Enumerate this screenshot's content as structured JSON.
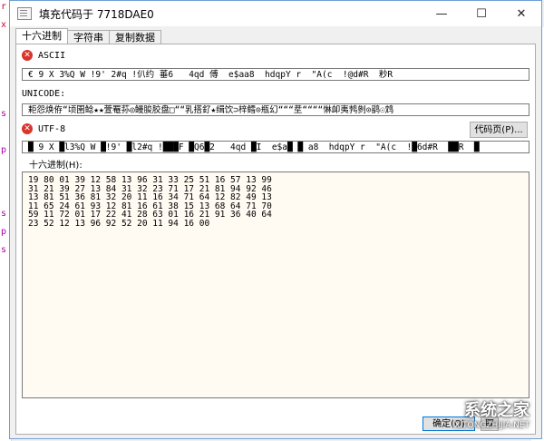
{
  "window": {
    "title": "填充代码于 7718DAE0",
    "minimize": "—",
    "maximize": "☐",
    "close": "✕"
  },
  "tabs": [
    "十六进制",
    "字符串",
    "复制数据"
  ],
  "ascii": {
    "label": "ASCII",
    "value": "€ 9 X 3%Q W !9' 2#q !仈约 菙6   4qd 傅  e$aa8  hdqpY r  \"A(c  !@d#R  粆R"
  },
  "unicode": {
    "label": "UNICODE:",
    "value": "耟怨焕侟“顷圉鲶★★萱罨荪◎鳗朘胶盘□““乳搭釕★缉饮⊃梓鳕⊙瓶幻“““坓““““惏卹夷鹁剼⊙鹞☉鸩"
  },
  "utf8": {
    "label": "UTF-8",
    "value": "█ 9 X █l3%Q W █!9' █l2#q !███F █Q6█2   4qd █I  e$a█ █ a8  hdqpY r  \"A(c  !█6d#R  ██R  █"
  },
  "codepage_button": "代码页(P)...",
  "hex": {
    "label": "十六进制(H):",
    "lines": [
      "19 80 01 39 12 58 13 96 31 33 25 51 16 57 13 99",
      "31 21 39 27 13 84 31 32 23 71 17 21 81 94 92 46",
      "13 81 51 36 81 32 20 11 16 34 71 64 12 82 49 13",
      "11 65 24 61 93 12 81 16 61 38 15 13 68 64 71 70",
      "59 11 72 01 17 22 41 28 63 01 16 21 91 36 40 64",
      "23 52 12 13 96 92 52 20 11 94 16 00"
    ]
  },
  "ok_button": "确定(O)",
  "cancel_button": "取",
  "watermark": {
    "text": "系统之家",
    "url": "XITONGZHIJIA.NET"
  },
  "background_strip": [
    "r",
    "x",
    "s",
    "p",
    "s",
    "p",
    "s"
  ],
  "icons": {
    "error": "error-icon"
  }
}
